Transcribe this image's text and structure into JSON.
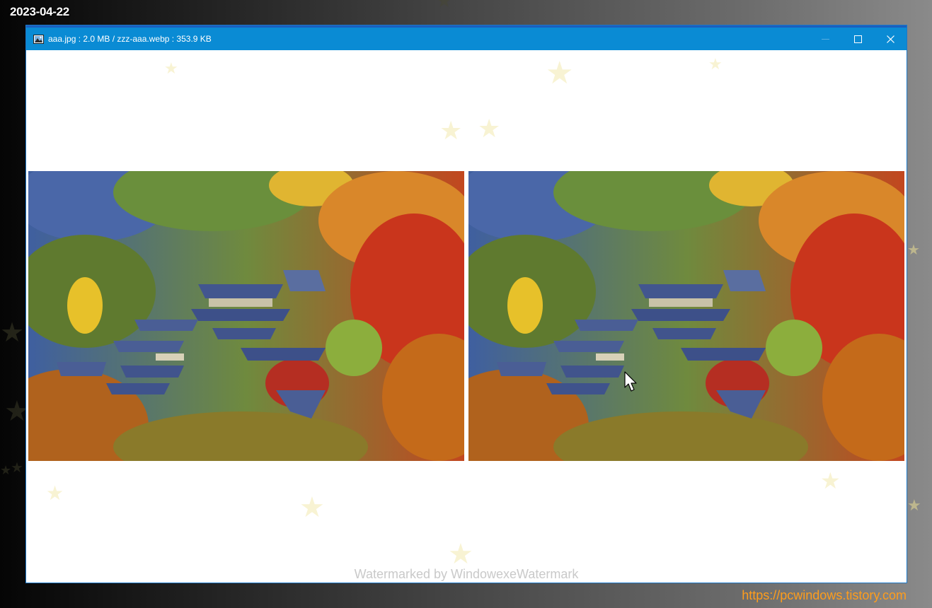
{
  "date_stamp": "2023-04-22",
  "window": {
    "title": "aaa.jpg : 2.0 MB / zzz-aaa.webp : 353.9 KB",
    "icons": {
      "app": "image-viewer-icon",
      "minimize": "minimize-icon",
      "maximize": "maximize-icon",
      "close": "close-icon"
    },
    "colors": {
      "titlebar": "#0a8bd4",
      "titlebar_accent": "#1a5fbf",
      "content_background": "#ffffff"
    }
  },
  "images": {
    "left": {
      "content": "autumn-temple-photo"
    },
    "right": {
      "content": "autumn-temple-photo"
    }
  },
  "watermark": "Watermarked by WindowexeWatermark",
  "footer": {
    "link": "https://pcwindows.tistory.com",
    "link_color": "#ff9d1c"
  },
  "decorations": {
    "icon": "star-icon",
    "star_color": "#e9dd91"
  }
}
